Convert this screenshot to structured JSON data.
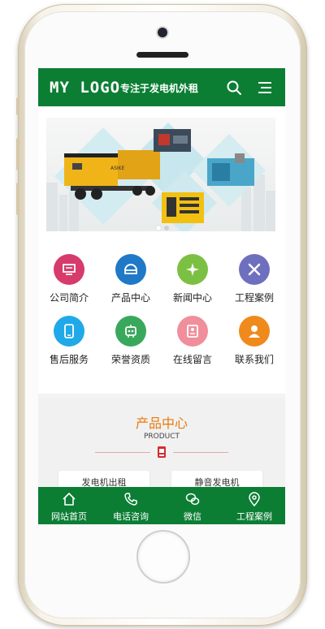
{
  "header": {
    "logo": "MY LOGO",
    "slogan": "专注于发电机外租"
  },
  "banner": {
    "generator_badge": "ASIKE"
  },
  "nav": [
    {
      "label": "公司简介",
      "color": "#d63b6b",
      "icon": "company-icon"
    },
    {
      "label": "产品中心",
      "color": "#1f79c7",
      "icon": "product-icon"
    },
    {
      "label": "新闻中心",
      "color": "#7bc043",
      "icon": "news-icon"
    },
    {
      "label": "工程案例",
      "color": "#6f6fbf",
      "icon": "tools-icon"
    },
    {
      "label": "售后服务",
      "color": "#20a9e8",
      "icon": "service-icon"
    },
    {
      "label": "荣誉资质",
      "color": "#3aa85c",
      "icon": "honor-icon"
    },
    {
      "label": "在线留言",
      "color": "#f08f9b",
      "icon": "message-icon"
    },
    {
      "label": "联系我们",
      "color": "#f08a1d",
      "icon": "contact-icon"
    }
  ],
  "products": {
    "title": "产品中心",
    "subtitle": "PRODUCT",
    "buttons": [
      "发电机出租",
      "静音发电机"
    ]
  },
  "footer": [
    {
      "label": "网站首页",
      "icon": "home-icon"
    },
    {
      "label": "电话咨询",
      "icon": "phone-icon"
    },
    {
      "label": "微信",
      "icon": "wechat-icon"
    },
    {
      "label": "工程案例",
      "icon": "location-icon"
    }
  ],
  "colors": {
    "brand_green": "#0b7e34",
    "accent_orange": "#e57c0a"
  }
}
